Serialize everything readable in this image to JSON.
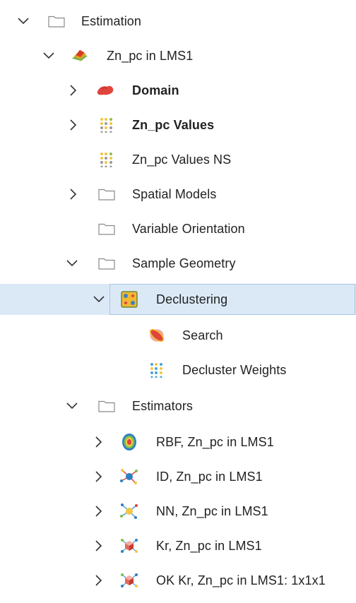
{
  "tree": {
    "estimation": {
      "label": "Estimation"
    },
    "zn_pc_in_lms1": {
      "label": "Zn_pc in LMS1"
    },
    "domain": {
      "label": "Domain"
    },
    "zn_pc_values": {
      "label": "Zn_pc Values"
    },
    "zn_pc_values_ns": {
      "label": "Zn_pc Values NS"
    },
    "spatial_models": {
      "label": "Spatial Models"
    },
    "variable_orientation": {
      "label": "Variable Orientation"
    },
    "sample_geometry": {
      "label": "Sample Geometry"
    },
    "declustering": {
      "label": "Declustering"
    },
    "search": {
      "label": "Search"
    },
    "decluster_weights": {
      "label": "Decluster Weights"
    },
    "estimators": {
      "label": "Estimators"
    },
    "rbf": {
      "label": "RBF, Zn_pc in LMS1"
    },
    "id": {
      "label": "ID, Zn_pc in LMS1"
    },
    "nn": {
      "label": "NN, Zn_pc in LMS1"
    },
    "kr": {
      "label": "Kr, Zn_pc in LMS1"
    },
    "ok_kr": {
      "label": "OK Kr, Zn_pc in LMS1: 1x1x1"
    }
  },
  "colors": {
    "selection_bg": "#dbe9f7",
    "selection_border": "#a7c4e6",
    "folder_outline": "#8a8a8a",
    "chevron": "#333333"
  }
}
